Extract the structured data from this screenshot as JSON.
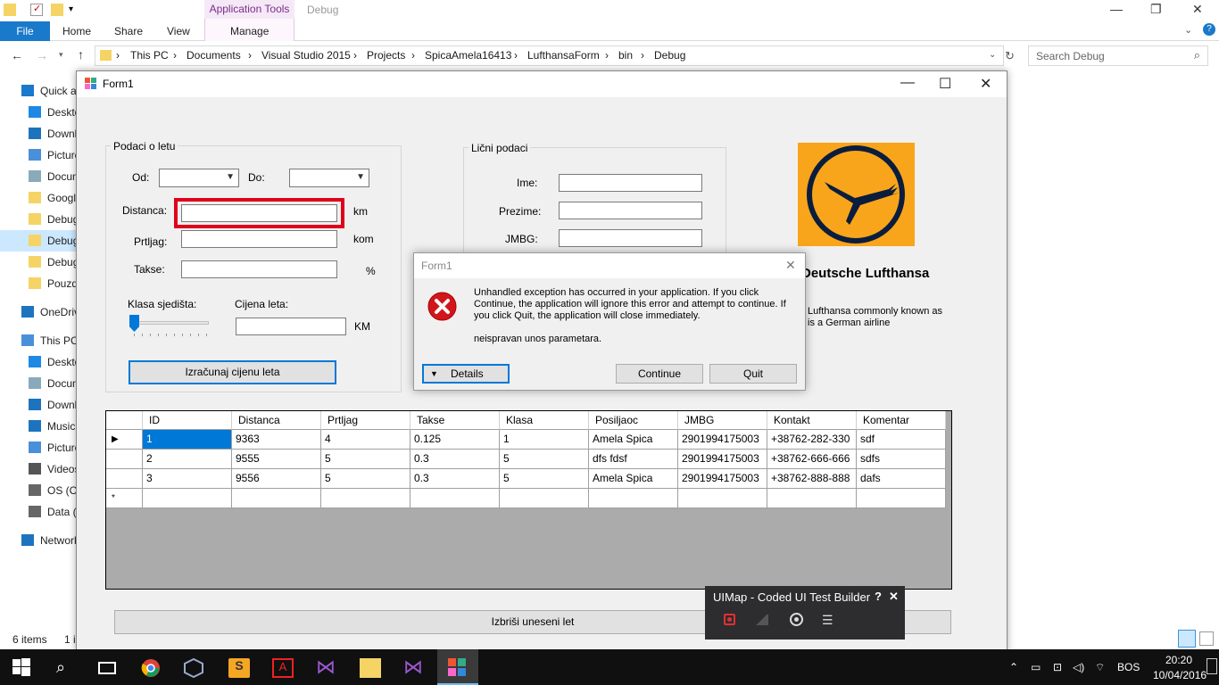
{
  "explorer": {
    "context_tab": "Application Tools",
    "window_title": "Debug",
    "tabs": {
      "file": "File",
      "home": "Home",
      "share": "Share",
      "view": "View",
      "manage": "Manage"
    },
    "breadcrumbs": [
      "This PC",
      "Documents",
      "Visual Studio 2015",
      "Projects",
      "SpicaAmela16413",
      "LufthansaForm",
      "bin",
      "Debug"
    ],
    "search_placeholder": "Search Debug",
    "sidebar": [
      {
        "label": "Quick access",
        "icon": "star-icon"
      },
      {
        "label": "Desktop",
        "icon": "desktop-icon"
      },
      {
        "label": "Downloads",
        "icon": "download-icon"
      },
      {
        "label": "Pictures",
        "icon": "pictures-icon"
      },
      {
        "label": "Documents",
        "icon": "document-icon"
      },
      {
        "label": "Google Drive",
        "icon": "folder-icon"
      },
      {
        "label": "Debug",
        "icon": "folder-icon"
      },
      {
        "label": "Debug",
        "icon": "folder-icon",
        "selected": true
      },
      {
        "label": "Debug",
        "icon": "folder-icon"
      },
      {
        "label": "Pouzdanost",
        "icon": "folder-icon"
      },
      {
        "label": "OneDrive",
        "icon": "cloud-icon"
      },
      {
        "label": "This PC",
        "icon": "computer-icon"
      },
      {
        "label": "Desktop",
        "icon": "desktop-icon"
      },
      {
        "label": "Documents",
        "icon": "document-icon"
      },
      {
        "label": "Downloads",
        "icon": "download-icon"
      },
      {
        "label": "Music",
        "icon": "music-icon"
      },
      {
        "label": "Pictures",
        "icon": "pictures-icon"
      },
      {
        "label": "Videos",
        "icon": "video-icon"
      },
      {
        "label": "OS (C:)",
        "icon": "drive-icon"
      },
      {
        "label": "Data (D:)",
        "icon": "drive-icon"
      },
      {
        "label": "Network",
        "icon": "network-icon"
      }
    ],
    "status_items": "6 items",
    "status_selected": "1 i"
  },
  "form": {
    "title": "Form1",
    "flight_group": {
      "title": "Podaci o letu",
      "from_label": "Od:",
      "to_label": "Do:",
      "distance_label": "Distanca:",
      "distance_unit": "km",
      "luggage_label": "Prtljag:",
      "luggage_unit": "kom",
      "taxes_label": "Takse:",
      "taxes_unit": "%",
      "seat_class_label": "Klasa sjedišta:",
      "price_label": "Cijena leta:",
      "price_unit": "KM",
      "calc_button": "Izračunaj cijenu leta"
    },
    "personal_group": {
      "title": "Lični podaci",
      "name_label": "Ime:",
      "surname_label": "Prezime:",
      "jmbg_label": "JMBG:"
    },
    "company_name": "Deutsche Lufthansa",
    "company_desc_1": "Lufthansa commonly known as",
    "company_desc_2": "is a German airline",
    "delete_button": "Izbriši uneseni let",
    "grid": {
      "columns": [
        "ID",
        "Distanca",
        "Prtljag",
        "Takse",
        "Klasa",
        "Posiljaoc",
        "JMBG",
        "Kontakt",
        "Komentar"
      ],
      "rows": [
        [
          "1",
          "9363",
          "4",
          "0.125",
          "1",
          "Amela Spica",
          "2901994175003",
          "+38762-282-330",
          "sdf"
        ],
        [
          "2",
          "9555",
          "5",
          "0.3",
          "5",
          "dfs fdsf",
          "2901994175003",
          "+38762-666-666",
          "sdfs"
        ],
        [
          "3",
          "9556",
          "5",
          "0.3",
          "5",
          "Amela Spica",
          "2901994175003",
          "+38762-888-888",
          "dafs"
        ]
      ],
      "new_row_marker": "*"
    }
  },
  "dialog": {
    "title": "Form1",
    "message_1": "Unhandled exception has occurred in your application. If you click",
    "message_2": "Continue, the application will ignore this error and attempt to continue. If",
    "message_3": "you click Quit, the application will close immediately.",
    "detail": "neispravan unos parametara.",
    "details_button": "Details",
    "continue_button": "Continue",
    "quit_button": "Quit"
  },
  "coded_ui": {
    "title": "UIMap - Coded UI Test Builder",
    "help": "?",
    "close": "✕"
  },
  "taskbar": {
    "language": "BOS",
    "time": "20:20",
    "date": "10/04/2016"
  },
  "colors": {
    "accent": "#0078d7",
    "highlight_box": "#e0001b",
    "lufthansa_yellow": "#f9a51b",
    "lufthansa_navy": "#0a1d3d"
  }
}
